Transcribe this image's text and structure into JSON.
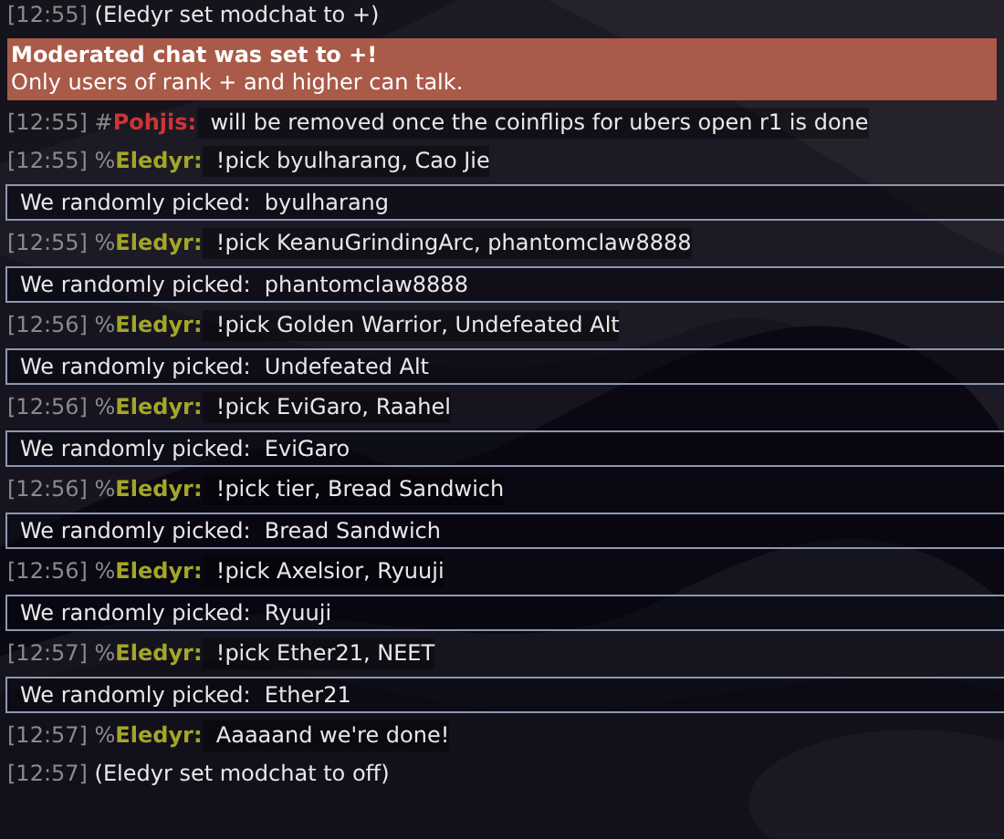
{
  "messages": [
    {
      "kind": "system",
      "time": "[12:55]",
      "text": "(Eledyr set modchat to +)"
    },
    {
      "kind": "banner",
      "title": "Moderated chat was set to +!",
      "text": "Only users of rank + and higher can talk."
    },
    {
      "kind": "chat",
      "time": "[12:55]",
      "rank": "#",
      "name": "Pohjis:",
      "color": "#d03434",
      "text": "will be removed once the coinflips for ubers open r1 is done"
    },
    {
      "kind": "chat",
      "time": "[12:55]",
      "rank": "%",
      "name": "Eledyr:",
      "color": "#a3a628",
      "text": "!pick byulharang, Cao Jie"
    },
    {
      "kind": "result",
      "text": "We randomly picked:  byulharang"
    },
    {
      "kind": "chat",
      "time": "[12:55]",
      "rank": "%",
      "name": "Eledyr:",
      "color": "#a3a628",
      "text": "!pick KeanuGrindingArc, phantomclaw8888"
    },
    {
      "kind": "result",
      "text": "We randomly picked:  phantomclaw8888"
    },
    {
      "kind": "chat",
      "time": "[12:56]",
      "rank": "%",
      "name": "Eledyr:",
      "color": "#a3a628",
      "text": "!pick Golden Warrior, Undefeated Alt"
    },
    {
      "kind": "result",
      "text": "We randomly picked:  Undefeated Alt"
    },
    {
      "kind": "chat",
      "time": "[12:56]",
      "rank": "%",
      "name": "Eledyr:",
      "color": "#a3a628",
      "text": "!pick EviGaro, Raahel"
    },
    {
      "kind": "result",
      "text": "We randomly picked:  EviGaro"
    },
    {
      "kind": "chat",
      "time": "[12:56]",
      "rank": "%",
      "name": "Eledyr:",
      "color": "#a3a628",
      "text": "!pick tier, Bread Sandwich"
    },
    {
      "kind": "result",
      "text": "We randomly picked:  Bread Sandwich"
    },
    {
      "kind": "chat",
      "time": "[12:56]",
      "rank": "%",
      "name": "Eledyr:",
      "color": "#a3a628",
      "text": "!pick Axelsior, Ryuuji"
    },
    {
      "kind": "result",
      "text": "We randomly picked:  Ryuuji"
    },
    {
      "kind": "chat",
      "time": "[12:57]",
      "rank": "%",
      "name": "Eledyr:",
      "color": "#a3a628",
      "text": "!pick Ether21, NEET"
    },
    {
      "kind": "result",
      "text": "We randomly picked:  Ether21"
    },
    {
      "kind": "chat",
      "time": "[12:57]",
      "rank": "%",
      "name": "Eledyr:",
      "color": "#a3a628",
      "text": "Aaaaand we're done!"
    },
    {
      "kind": "system",
      "time": "[12:57]",
      "text": "(Eledyr set modchat to off)"
    }
  ]
}
